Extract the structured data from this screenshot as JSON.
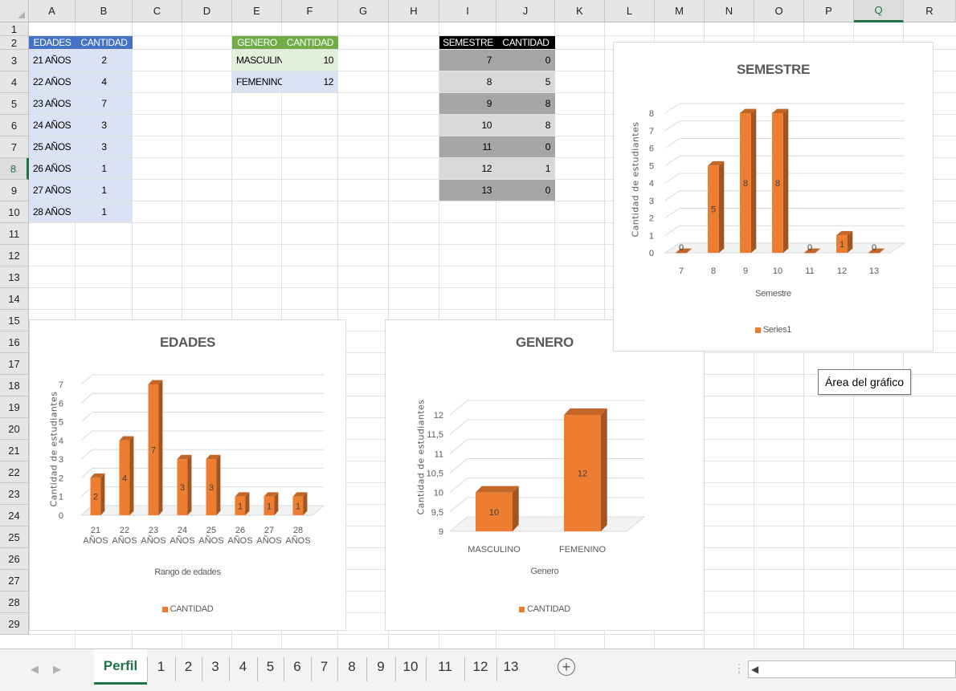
{
  "columns": [
    "A",
    "B",
    "C",
    "D",
    "E",
    "F",
    "G",
    "H",
    "I",
    "J",
    "K",
    "L",
    "M",
    "N",
    "O",
    "P",
    "Q",
    "R"
  ],
  "selected_column": "Q",
  "rows": [
    "1",
    "2",
    "3",
    "4",
    "5",
    "6",
    "7",
    "8",
    "9",
    "10",
    "11",
    "12",
    "13",
    "14",
    "15",
    "16",
    "17",
    "18",
    "19",
    "20",
    "21",
    "22",
    "23",
    "24",
    "25",
    "26",
    "27",
    "28",
    "29"
  ],
  "selected_row": "8",
  "tables": {
    "edades": {
      "header": [
        "EDADES",
        "CANTIDAD"
      ],
      "header_color": "#4472c4",
      "body_color": "#dae3f3",
      "rows": [
        [
          "21 AÑOS",
          "2"
        ],
        [
          "22 AÑOS",
          "4"
        ],
        [
          "23 AÑOS",
          "7"
        ],
        [
          "24 AÑOS",
          "3"
        ],
        [
          "25 AÑOS",
          "3"
        ],
        [
          "26 AÑOS",
          "1"
        ],
        [
          "27 AÑOS",
          "1"
        ],
        [
          "28 AÑOS",
          "1"
        ]
      ]
    },
    "genero": {
      "header": [
        "GENERO",
        "CANTIDAD"
      ],
      "header_color": "#70ad47",
      "rows": [
        [
          "MASCULINC",
          "10"
        ],
        [
          "FEMENINO",
          "12"
        ]
      ],
      "row_colors": [
        "#e2efda",
        "#dae3f3"
      ]
    },
    "semestre": {
      "header": [
        "SEMESTRE",
        "CANTIDAD"
      ],
      "header_color": "#000000",
      "rows": [
        [
          "7",
          "0"
        ],
        [
          "8",
          "5"
        ],
        [
          "9",
          "8"
        ],
        [
          "10",
          "8"
        ],
        [
          "11",
          "0"
        ],
        [
          "12",
          "1"
        ],
        [
          "13",
          "0"
        ]
      ],
      "row_colors": [
        "#a6a6a6",
        "#d9d9d9"
      ]
    }
  },
  "chart_data": [
    {
      "id": "edades",
      "type": "bar",
      "title": "EDADES",
      "categories": [
        "21 AÑOS",
        "22 AÑOS",
        "23 AÑOS",
        "24 AÑOS",
        "25 AÑOS",
        "26 AÑOS",
        "27 AÑOS",
        "28 AÑOS"
      ],
      "category_lines": [
        [
          "21",
          "AÑOS"
        ],
        [
          "22",
          "AÑOS"
        ],
        [
          "23",
          "AÑOS"
        ],
        [
          "24",
          "AÑOS"
        ],
        [
          "25",
          "AÑOS"
        ],
        [
          "26",
          "AÑOS"
        ],
        [
          "27",
          "AÑOS"
        ],
        [
          "28",
          "AÑOS"
        ]
      ],
      "series": [
        {
          "name": "CANTIDAD",
          "values": [
            2,
            4,
            7,
            3,
            3,
            1,
            1,
            1
          ]
        }
      ],
      "xlabel": "Rango de edades",
      "ylabel": "Cantidad de estudiantes",
      "ylim": [
        0,
        7
      ],
      "yticks": [
        "0",
        "1",
        "2",
        "3",
        "4",
        "5",
        "6",
        "7"
      ],
      "legend": "bottom",
      "legend_label": "CANTIDAD",
      "color": "#ed7d31",
      "grid": true
    },
    {
      "id": "genero",
      "type": "bar",
      "title": "GENERO",
      "categories": [
        "MASCULINO",
        "FEMENINO"
      ],
      "series": [
        {
          "name": "CANTIDAD",
          "values": [
            10,
            12
          ]
        }
      ],
      "xlabel": "Genero",
      "ylabel": "Cantidad de estudiantes",
      "ylim": [
        9,
        12
      ],
      "yticks": [
        "9",
        "9,5",
        "10",
        "10,5",
        "11",
        "11,5",
        "12"
      ],
      "legend": "bottom",
      "legend_label": "CANTIDAD",
      "color": "#ed7d31",
      "grid": true
    },
    {
      "id": "semestre",
      "type": "bar",
      "title": "SEMESTRE",
      "categories": [
        "7",
        "8",
        "9",
        "10",
        "11",
        "12",
        "13"
      ],
      "series": [
        {
          "name": "Series1",
          "values": [
            0,
            5,
            8,
            8,
            0,
            1,
            0
          ]
        }
      ],
      "xlabel": "Semestre",
      "ylabel": "Cantidad de estudiantes",
      "ylim": [
        0,
        8
      ],
      "yticks": [
        "0",
        "1",
        "2",
        "3",
        "4",
        "5",
        "6",
        "7",
        "8"
      ],
      "legend": "bottom",
      "legend_label": "Series1",
      "color": "#ed7d31",
      "grid": true
    }
  ],
  "tooltip": "Área del gráfico",
  "sheet_tabs": [
    "Perfil",
    "1",
    "2",
    "3",
    "4",
    "5",
    "6",
    "7",
    "8",
    "9",
    "10",
    "11",
    "12",
    "13"
  ],
  "active_tab": "Perfil",
  "add_sheet_icon": "plus-circle-icon",
  "nav_icons": [
    "chevron-left-icon",
    "chevron-right-icon"
  ]
}
